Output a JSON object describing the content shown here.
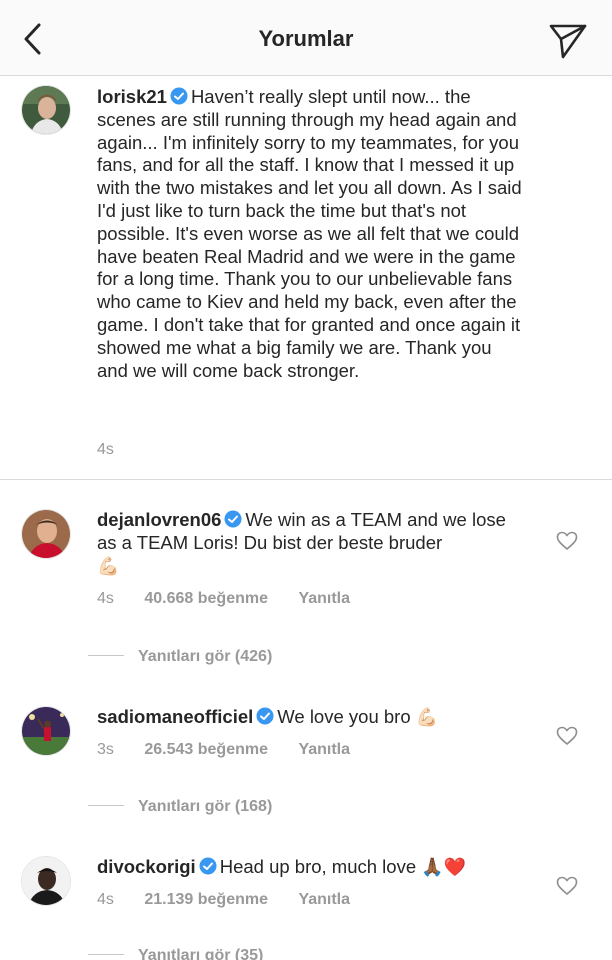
{
  "header": {
    "title": "Yorumlar"
  },
  "post": {
    "username": "lorisk21",
    "text": "Haven’t really slept until now... the scenes are still running through my head again and again... I'm infinitely sorry to my teammates, for you fans, and for all the staff. I know that I messed it up with the two mistakes and let you all down. As I said I'd just like to turn back the time but that's not possible. It's even worse as we all felt that we could have beaten Real Madrid and we were in the game for a long time. Thank you to our unbelievable fans who came to Kiev and held my back, even after the game. I don't take that for granted and once again it showed me what a big family we are. Thank you and we will come back stronger.",
    "time": "4s"
  },
  "comments": [
    {
      "username": "dejanlovren06",
      "text": "We win as a TEAM and we lose as a TEAM Loris! Du bist der beste bruder",
      "emoji": "💪🏻",
      "time": "4s",
      "likes": "40.668 beğenme",
      "reply": "Yanıtla",
      "view_replies": "Yanıtları gör (426)"
    },
    {
      "username": "sadiomaneofficiel",
      "text": "We love you bro",
      "emoji": "💪🏻",
      "time": "3s",
      "likes": "26.543 beğenme",
      "reply": "Yanıtla",
      "view_replies": "Yanıtları gör (168)"
    },
    {
      "username": "divockorigi",
      "text": "Head up bro, much love",
      "emoji": "🙏🏾❤️",
      "time": "4s",
      "likes": "21.139 beğenme",
      "reply": "Yanıtla",
      "view_replies": "Yanıtları gör (35)"
    }
  ],
  "colors": {
    "verified": "#3897f0",
    "meta": "#999999",
    "text": "#262626",
    "divider": "#dbdbdb"
  }
}
